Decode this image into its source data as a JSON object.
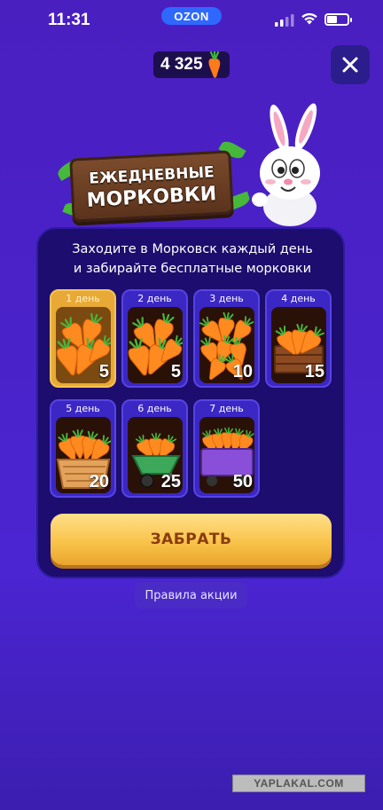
{
  "status_bar": {
    "time": "11:31",
    "app_badge": "OZON"
  },
  "balance": {
    "value": "4 325",
    "icon": "carrot-icon"
  },
  "title": {
    "line1": "ЕЖЕДНЕВНЫЕ",
    "line2": "МОРКОВКИ"
  },
  "panel": {
    "description_line1": "Заходите в Морковск каждый день",
    "description_line2": "и забирайте бесплатные морковки"
  },
  "days": [
    {
      "label": "1 день",
      "amount": "5",
      "active": true,
      "image": "carrots-small"
    },
    {
      "label": "2 день",
      "amount": "5",
      "active": false,
      "image": "carrots-small"
    },
    {
      "label": "3 день",
      "amount": "10",
      "active": false,
      "image": "carrots-pile"
    },
    {
      "label": "4 день",
      "amount": "15",
      "active": false,
      "image": "carrots-crate"
    },
    {
      "label": "5 день",
      "amount": "20",
      "active": false,
      "image": "carrots-basket"
    },
    {
      "label": "6 день",
      "amount": "25",
      "active": false,
      "image": "carrots-wheelbarrow"
    },
    {
      "label": "7 день",
      "amount": "50",
      "active": false,
      "image": "carrots-cart"
    }
  ],
  "claim_button": {
    "label": "ЗАБРАТЬ"
  },
  "rules_link": {
    "label": "Правила акции"
  },
  "watermark": "YAPLAKAL.COM",
  "colors": {
    "background": "#4a22c9",
    "panel": "#1c0d6e",
    "card": "#3b27c4",
    "card_active": "#e8a937",
    "button": "#f9c34a",
    "button_text": "#8a3c0e"
  }
}
